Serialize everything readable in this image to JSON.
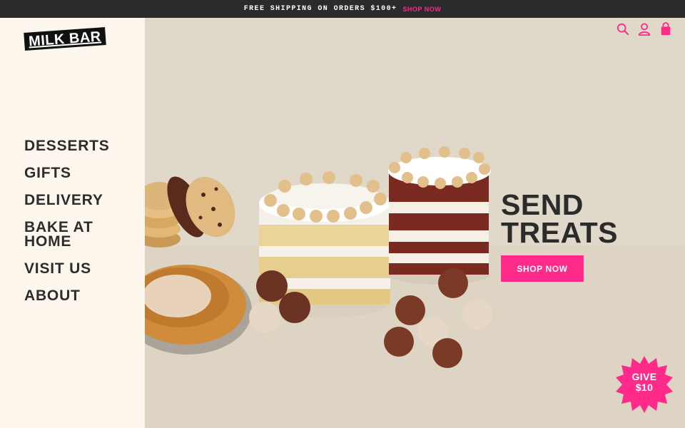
{
  "announcement": {
    "message": "FREE SHIPPING ON ORDERS $100+",
    "cta": "SHOP NOW"
  },
  "brand": {
    "logo_text": "MILK BAR"
  },
  "nav": {
    "items": [
      {
        "label": "DESSERTS"
      },
      {
        "label": "GIFTS"
      },
      {
        "label": "DELIVERY"
      },
      {
        "label": "BAKE AT HOME"
      },
      {
        "label": "VISIT US"
      },
      {
        "label": "ABOUT"
      }
    ]
  },
  "header_icons": [
    "search-icon",
    "account-icon",
    "shopping-bag-icon"
  ],
  "hero": {
    "headline_line1": "SEND",
    "headline_line2": "TREATS",
    "cta": "SHOP NOW"
  },
  "promo_badge": {
    "line1": "GIVE",
    "line2": "$10"
  },
  "colors": {
    "accent": "#ff2a8a",
    "topbar_bg": "#2b2b2b",
    "sidebar_bg": "#fdf6ec",
    "hero_bg": "#e0d8c8",
    "text_dark": "#2b2b2b"
  }
}
